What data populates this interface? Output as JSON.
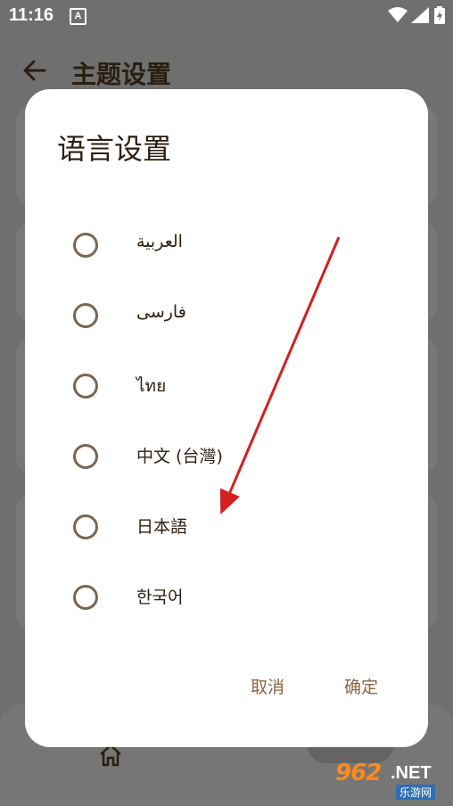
{
  "status_bar": {
    "time": "11:16",
    "notification_glyph": "A",
    "icons": [
      "wifi-icon",
      "signal-icon",
      "battery-icon"
    ]
  },
  "app_bar": {
    "title": "主题设置",
    "back_icon": "back-arrow-icon"
  },
  "dialog": {
    "title": "语言设置",
    "options": [
      {
        "label": "العربية",
        "selected": false
      },
      {
        "label": "فارسی",
        "selected": false
      },
      {
        "label": "ไทย",
        "selected": false
      },
      {
        "label": "中文 (台灣)",
        "selected": false
      },
      {
        "label": "日本語",
        "selected": false
      },
      {
        "label": "한국어",
        "selected": false
      }
    ],
    "cancel_label": "取消",
    "confirm_label": "确定"
  },
  "bottom_nav": {
    "home_icon": "home-icon"
  },
  "watermark": {
    "main": "962",
    "suffix": ".NET",
    "sub": "乐游网"
  },
  "colors": {
    "dim_background": "#6f6f6f",
    "dialog_background": "#ffffff",
    "title_text": "#2a1e10",
    "radio_border": "#7a6554",
    "button_text": "#8a6440",
    "arrow": "#d42020"
  }
}
